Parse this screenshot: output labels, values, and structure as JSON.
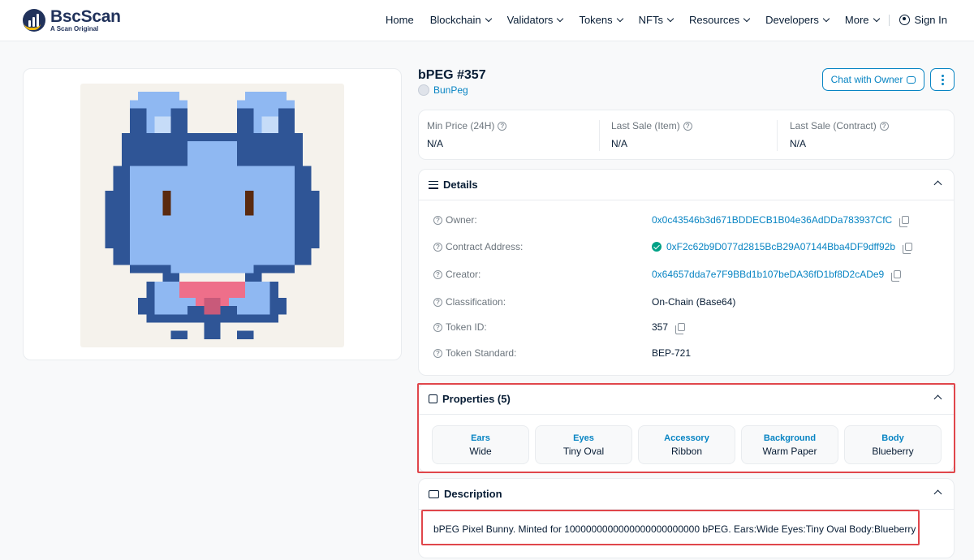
{
  "header": {
    "logo_name": "BscScan",
    "logo_sub": "A Scan Original",
    "nav": [
      {
        "label": "Home",
        "dropdown": false
      },
      {
        "label": "Blockchain",
        "dropdown": true
      },
      {
        "label": "Validators",
        "dropdown": true
      },
      {
        "label": "Tokens",
        "dropdown": true
      },
      {
        "label": "NFTs",
        "dropdown": true
      },
      {
        "label": "Resources",
        "dropdown": true
      },
      {
        "label": "Developers",
        "dropdown": true
      },
      {
        "label": "More",
        "dropdown": true
      }
    ],
    "signin": "Sign In"
  },
  "token": {
    "title": "bPEG #357",
    "collection": "BunPeg",
    "chat_label": "Chat with Owner"
  },
  "prices": [
    {
      "label": "Min Price (24H)",
      "value": "N/A"
    },
    {
      "label": "Last Sale (Item)",
      "value": "N/A"
    },
    {
      "label": "Last Sale (Contract)",
      "value": "N/A"
    }
  ],
  "details": {
    "heading": "Details",
    "rows": [
      {
        "label": "Owner:",
        "value": "0x0c43546b3d671BDDECB1B04e36AdDDa783937CfC"
      },
      {
        "label": "Contract Address:",
        "value": "0xF2c62b9D077d2815BcB29A07144Bba4DF9dff92b"
      },
      {
        "label": "Creator:",
        "value": "0x64657dda7e7F9BBd1b107beDA36fD1bf8D2cADe9"
      },
      {
        "label": "Classification:",
        "value": "On-Chain (Base64)"
      },
      {
        "label": "Token ID:",
        "value": "357"
      },
      {
        "label": "Token Standard:",
        "value": "BEP-721"
      }
    ]
  },
  "properties": {
    "heading": "Properties (5)",
    "items": [
      {
        "key": "Ears",
        "value": "Wide"
      },
      {
        "key": "Eyes",
        "value": "Tiny Oval"
      },
      {
        "key": "Accessory",
        "value": "Ribbon"
      },
      {
        "key": "Background",
        "value": "Warm Paper"
      },
      {
        "key": "Body",
        "value": "Blueberry"
      }
    ]
  },
  "description": {
    "heading": "Description",
    "text": "bPEG Pixel Bunny. Minted for 1000000000000000000000000 bPEG. Ears:Wide Eyes:Tiny Oval Body:Blueberry"
  },
  "colors": {
    "accent": "#0784c3",
    "highlight": "#e0464b",
    "bunny_body": "#8fb8f2",
    "bunny_dark": "#2f5596",
    "bunny_light": "#c6dcf8",
    "ribbon": "#ee6f8a",
    "eyes": "#5a2a10",
    "background": "#f5f2ec"
  }
}
